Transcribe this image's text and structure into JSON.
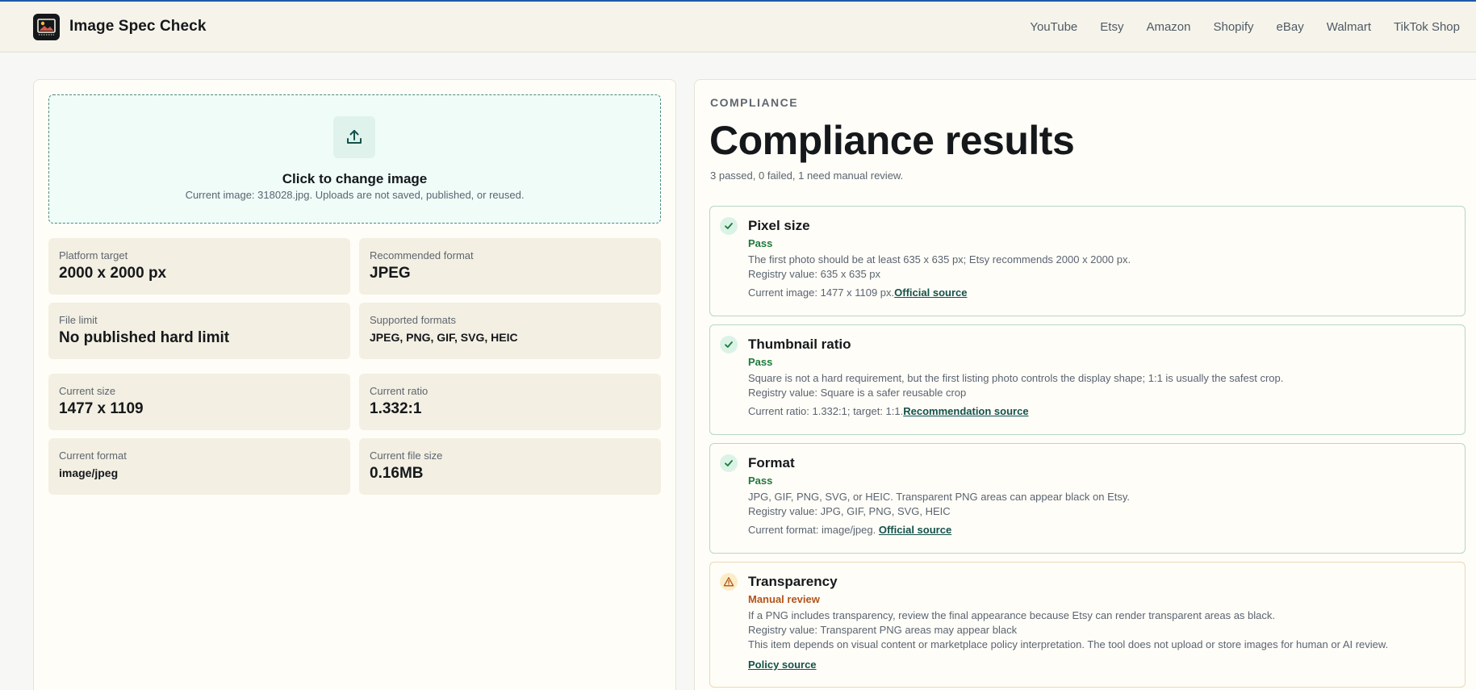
{
  "header": {
    "brand": "Image Spec Check",
    "nav": [
      "YouTube",
      "Etsy",
      "Amazon",
      "Shopify",
      "eBay",
      "Walmart",
      "TikTok Shop"
    ]
  },
  "upload": {
    "title": "Click to change image",
    "subtitle": "Current image: 318028.jpg. Uploads are not saved, published, or reused."
  },
  "specs": [
    {
      "label": "Platform target",
      "value": "2000 x 2000 px"
    },
    {
      "label": "Recommended format",
      "value": "JPEG"
    },
    {
      "label": "File limit",
      "value": "No published hard limit"
    },
    {
      "label": "Supported formats",
      "value": "JPEG, PNG, GIF, SVG, HEIC"
    }
  ],
  "current": [
    {
      "label": "Current size",
      "value": "1477 x 1109"
    },
    {
      "label": "Current ratio",
      "value": "1.332:1"
    },
    {
      "label": "Current format",
      "value": "image/jpeg"
    },
    {
      "label": "Current file size",
      "value": "0.16MB"
    }
  ],
  "compliance": {
    "eyebrow": "COMPLIANCE",
    "title": "Compliance results",
    "summary": "3 passed, 0 failed, 1 need manual review."
  },
  "checks": [
    {
      "title": "Pixel size",
      "status": "Pass",
      "desc": "The first photo should be at least 635 x 635 px; Etsy recommends 2000 x 2000 px.",
      "registry": "Registry value: 635 x 635 px",
      "current": "Current image: 1477 x 1109 px.",
      "link": "Official source"
    },
    {
      "title": "Thumbnail ratio",
      "status": "Pass",
      "desc": "Square is not a hard requirement, but the first listing photo controls the display shape; 1:1 is usually the safest crop.",
      "registry": "Registry value: Square is a safer reusable crop",
      "current": "Current ratio: 1.332:1; target: 1:1.",
      "link": "Recommendation source"
    },
    {
      "title": "Format",
      "status": "Pass",
      "desc": "JPG, GIF, PNG, SVG, or HEIC. Transparent PNG areas can appear black on Etsy.",
      "registry": "Registry value: JPG, GIF, PNG, SVG, HEIC",
      "current": "Current format: image/jpeg.",
      "link": "Official source"
    },
    {
      "title": "Transparency",
      "status": "Manual review",
      "desc": "If a PNG includes transparency, review the final appearance because Etsy can render transparent areas as black.",
      "registry": "Registry value: Transparent PNG areas may appear black",
      "note": "This item depends on visual content or marketplace policy interpretation. The tool does not upload or store images for human or AI review.",
      "link": "Policy source"
    }
  ],
  "colors": {
    "accent": "#13514a",
    "pass": "#1e7a3c",
    "warn": "#b3541a"
  }
}
